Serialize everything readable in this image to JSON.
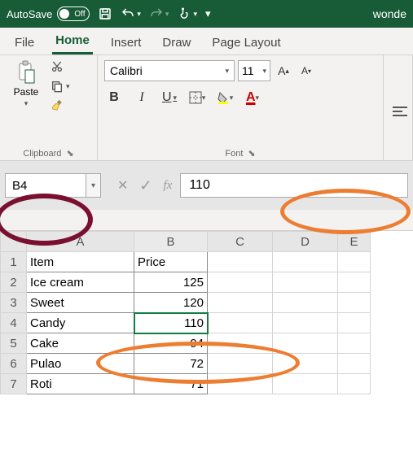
{
  "titlebar": {
    "autosave_label": "AutoSave",
    "autosave_state": "Off",
    "doc_title": "wonde"
  },
  "tabs": {
    "file": "File",
    "home": "Home",
    "insert": "Insert",
    "draw": "Draw",
    "pagelayout": "Page Layout"
  },
  "ribbon": {
    "paste_label": "Paste",
    "clipboard_label": "Clipboard",
    "font_name": "Calibri",
    "font_size": "11",
    "font_label": "Font",
    "bold": "B",
    "italic": "I",
    "underline": "U"
  },
  "namebox": {
    "value": "B4"
  },
  "formula": {
    "value": "110"
  },
  "columns": [
    "A",
    "B",
    "C",
    "D",
    "E"
  ],
  "rows": [
    "1",
    "2",
    "3",
    "4",
    "5",
    "6",
    "7"
  ],
  "cells": {
    "A1": "Item",
    "B1": "Price",
    "A2": "Ice cream",
    "B2": "125",
    "A3": "Sweet",
    "B3": "120",
    "A4": "Candy",
    "B4": "110",
    "A5": "Cake",
    "B5": "94",
    "A6": "Pulao",
    "B6": "72",
    "A7": "Roti",
    "B7": "71"
  },
  "chart_data": {
    "type": "table",
    "title": "",
    "columns": [
      "Item",
      "Price"
    ],
    "rows": [
      [
        "Ice cream",
        125
      ],
      [
        "Sweet",
        120
      ],
      [
        "Candy",
        110
      ],
      [
        "Cake",
        94
      ],
      [
        "Pulao",
        72
      ],
      [
        "Roti",
        71
      ]
    ]
  },
  "annotations": {
    "namebox_color": "#7a1030",
    "cell_color": "#ed7d31",
    "formula_color": "#ed7d31"
  }
}
